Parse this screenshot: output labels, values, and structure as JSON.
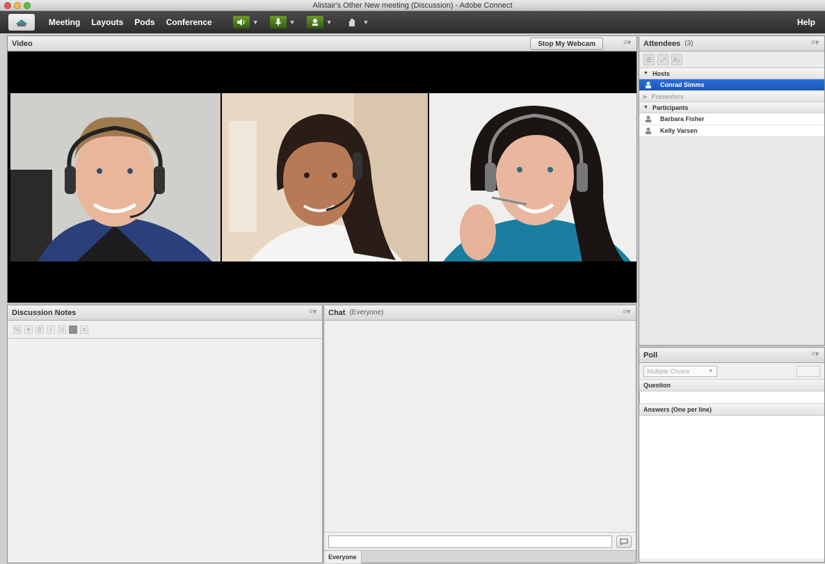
{
  "window": {
    "title": "Alistair's Other New meeting (Discussion) - Adobe Connect"
  },
  "menubar": {
    "items": [
      "Meeting",
      "Layouts",
      "Pods",
      "Conference"
    ],
    "help": "Help"
  },
  "video_pod": {
    "title": "Video",
    "webcam_button": "Stop My Webcam"
  },
  "attendees_pod": {
    "title": "Attendees",
    "count": "(3)",
    "groups": {
      "hosts": "Hosts",
      "presenters": "Presenters",
      "participants": "Participants"
    },
    "host_name": "Conrad Simms",
    "participants": [
      "Barbara Fisher",
      "Kelly Varsen"
    ]
  },
  "poll_pod": {
    "title": "Poll",
    "type_select": "Multiple Choice",
    "question_label": "Question",
    "answers_label": "Answers (One per line)"
  },
  "notes_pod": {
    "title": "Discussion Notes"
  },
  "chat_pod": {
    "title": "Chat",
    "scope": "(Everyone)",
    "tab_label": "Everyone"
  },
  "colors": {
    "selection_blue": "#1f5fc6",
    "menubar": "#2c2c2c"
  }
}
